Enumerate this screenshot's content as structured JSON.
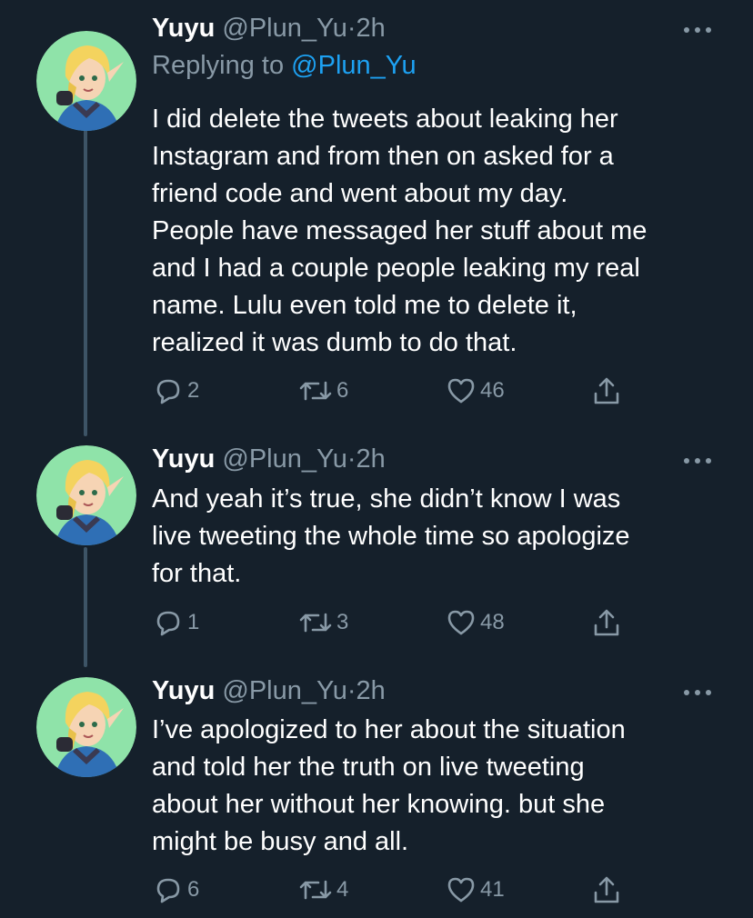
{
  "tweets": [
    {
      "name": "Yuyu",
      "handle": "@Plun_Yu",
      "separator": "·",
      "time": "2h",
      "reply_prefix": "Replying to ",
      "reply_mention": "@Plun_Yu",
      "lines": [
        "I did delete the tweets about leaking her",
        "Instagram and from then on asked for a",
        "friend code and went about my day.",
        "People have messaged her stuff about me",
        "and I had a couple people leaking my real",
        "name. Lulu even told me to delete it,",
        "realized it was dumb to do that."
      ],
      "replies": "2",
      "retweets": "6",
      "likes": "46"
    },
    {
      "name": "Yuyu",
      "handle": "@Plun_Yu",
      "separator": "·",
      "time": "2h",
      "lines": [
        "And yeah it’s true, she didn’t know I was",
        "live tweeting the whole time so apologize",
        "for that."
      ],
      "replies": "1",
      "retweets": "3",
      "likes": "48"
    },
    {
      "name": "Yuyu",
      "handle": "@Plun_Yu",
      "separator": "·",
      "time": "2h",
      "lines": [
        "I’ve apologized to her about the situation",
        "and told her the truth on live tweeting",
        "about her without her knowing. but she",
        "might be busy and all."
      ],
      "replies": "6",
      "retweets": "4",
      "likes": "41"
    }
  ],
  "icons": {
    "reply": "reply-icon",
    "retweet": "retweet-icon",
    "like": "heart-icon",
    "share": "share-icon",
    "more": "more-icon"
  },
  "colors": {
    "background": "#15202b",
    "text": "#ffffff",
    "muted": "#8899a6",
    "link": "#1da1f2",
    "thread_line": "#3d5466",
    "avatar_bg": "#8fe3a9"
  }
}
